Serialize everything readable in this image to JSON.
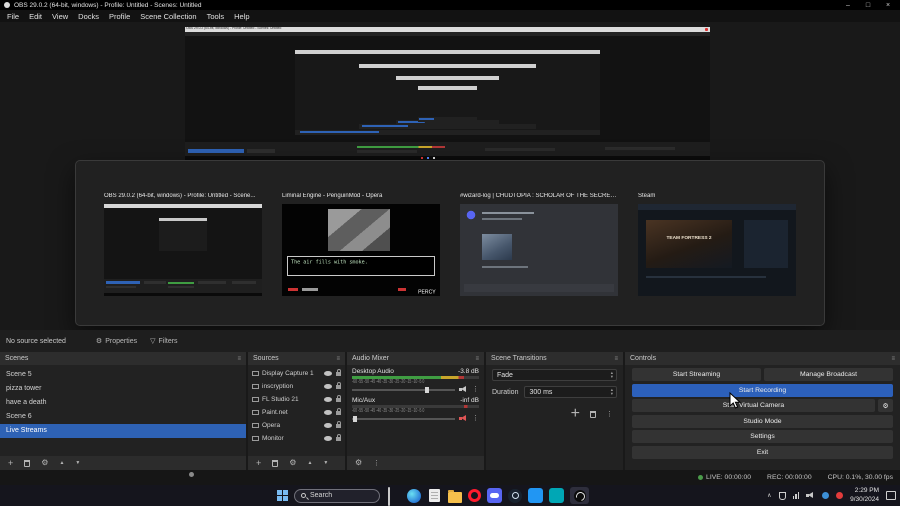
{
  "colors": {
    "accent_blue": "#2e62b5",
    "record_hover": "#2c60bb",
    "meter_green": "#3f9d42",
    "meter_yellow": "#c9a62b",
    "meter_red": "#b23737"
  },
  "window": {
    "title": "OBS 29.0.2 (64-bit, windows) - Profile: Untitled - Scenes: Untitled"
  },
  "menu": {
    "items": [
      "File",
      "Edit",
      "View",
      "Docks",
      "Profile",
      "Scene Collection",
      "Tools",
      "Help"
    ]
  },
  "overlay": {
    "cards": [
      {
        "title": "OBS 29.0.2 (64-bit, windows) - Profile: Untitled - Scene..."
      },
      {
        "title": "Liminal Engine - PenguinMod - Opera",
        "message": "The air fills with smoke.",
        "hud": "PERCY"
      },
      {
        "title": "#wizard-log | CHUDTOPIA : SCHOLAR OF THE SECRET B..."
      },
      {
        "title": "Steam",
        "banner": "TEAM FORTRESS 2"
      }
    ]
  },
  "source_row": {
    "status": "No source selected",
    "properties": "Properties",
    "filters": "Filters"
  },
  "scenes": {
    "title": "Scenes",
    "items": [
      "Scene 5",
      "pizza tower",
      "have a death",
      "Scene 6",
      "Live Streams"
    ],
    "selected": "Live Streams"
  },
  "sources": {
    "title": "Sources",
    "items": [
      "Display Capture 1",
      "inscryption",
      "FL Studio 21",
      "Paint.net",
      "Opera",
      "Monitor"
    ]
  },
  "mixer": {
    "title": "Audio Mixer",
    "channels": [
      {
        "name": "Desktop Audio",
        "level": "-3.8 dB"
      },
      {
        "name": "Mic/Aux",
        "level": "-inf dB"
      }
    ],
    "scale": [
      "-60",
      "-55",
      "-50",
      "-45",
      "-40",
      "-35",
      "-30",
      "-25",
      "-20",
      "-15",
      "-10",
      "-5",
      "0"
    ]
  },
  "transitions": {
    "title": "Scene Transitions",
    "value": "Fade",
    "duration_label": "Duration",
    "duration": "300 ms"
  },
  "controls": {
    "title": "Controls",
    "start_streaming": "Start Streaming",
    "manage_broadcast": "Manage Broadcast",
    "start_recording": "Start Recording",
    "start_virtual_camera": "Start Virtual Camera",
    "studio_mode": "Studio Mode",
    "settings": "Settings",
    "exit": "Exit"
  },
  "status": {
    "live": "LIVE: 00:00:00",
    "rec": "REC: 00:00:00",
    "cpu": "CPU: 0.1%, 30.00 fps"
  },
  "taskbar": {
    "search": "Search",
    "time": "2:29 PM",
    "date": "9/30/2024"
  },
  "icons": {
    "minimize": "–",
    "maximize": "□",
    "close": "×",
    "gear": "⚙",
    "plus": "+",
    "dots": "⋮",
    "grip": "≡",
    "up": "▲",
    "down": "▼",
    "combo_up": "▴",
    "combo_down": "▾",
    "chevron_up": "∧",
    "funnel": "▽"
  }
}
